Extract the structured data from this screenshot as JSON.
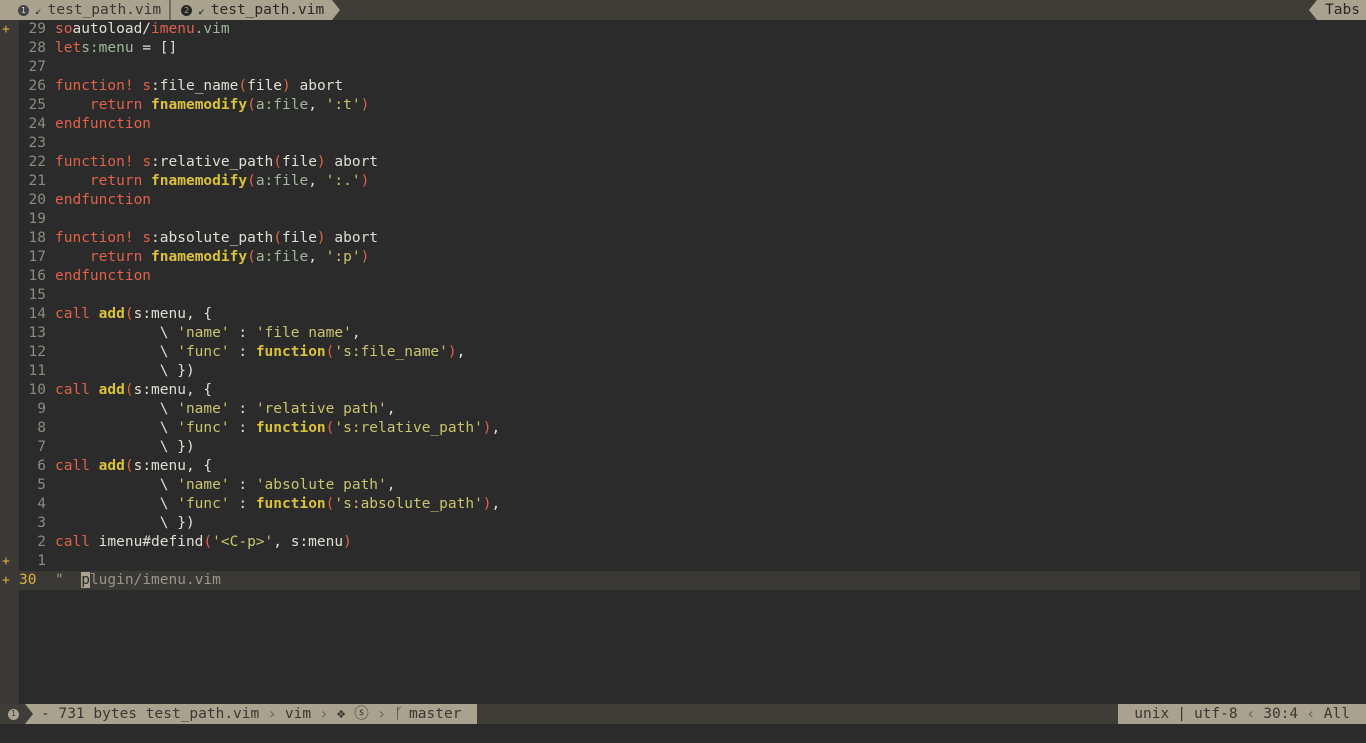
{
  "tabline": {
    "tabs": [
      {
        "num": "1",
        "modified_icon": "↙",
        "label": "test_path.vim",
        "active": false
      },
      {
        "num": "2",
        "modified_icon": "↙",
        "label": "test_path.vim",
        "active": true
      }
    ],
    "right_label": "Tabs"
  },
  "signs": [
    "+",
    "+",
    "+"
  ],
  "lines": [
    {
      "n": "29",
      "code": [
        [
          "kw",
          "so"
        ],
        [
          "",
          "autoload/"
        ],
        [
          "path",
          "imenu"
        ],
        [
          "ext",
          ".vim"
        ]
      ]
    },
    {
      "n": "28",
      "code": [
        [
          "kw",
          "let"
        ],
        [
          "",
          ""
        ],
        [
          "var",
          "s:menu"
        ],
        [
          "",
          " = []"
        ]
      ]
    },
    {
      "n": "27",
      "code": []
    },
    {
      "n": "26",
      "code": [
        [
          "kw",
          "function!"
        ],
        [
          "",
          " "
        ],
        [
          "kw",
          "s"
        ],
        [
          "",
          ":file_name"
        ],
        [
          "paren",
          "("
        ],
        [
          "",
          "file"
        ],
        [
          "paren",
          ")"
        ],
        [
          "",
          " abort"
        ]
      ]
    },
    {
      "n": "25",
      "code": [
        [
          "",
          "    "
        ],
        [
          "kw",
          "return"
        ],
        [
          "",
          " "
        ],
        [
          "fn",
          "fnamemodify"
        ],
        [
          "paren",
          "("
        ],
        [
          "var",
          "a:file"
        ],
        [
          "",
          ", "
        ],
        [
          "str",
          "':t'"
        ],
        [
          "paren",
          ")"
        ]
      ]
    },
    {
      "n": "24",
      "code": [
        [
          "kw",
          "endfunction"
        ]
      ]
    },
    {
      "n": "23",
      "code": []
    },
    {
      "n": "22",
      "code": [
        [
          "kw",
          "function!"
        ],
        [
          "",
          " "
        ],
        [
          "kw",
          "s"
        ],
        [
          "",
          ":relative_path"
        ],
        [
          "paren",
          "("
        ],
        [
          "",
          "file"
        ],
        [
          "paren",
          ")"
        ],
        [
          "",
          " abort"
        ]
      ]
    },
    {
      "n": "21",
      "code": [
        [
          "",
          "    "
        ],
        [
          "kw",
          "return"
        ],
        [
          "",
          " "
        ],
        [
          "fn",
          "fnamemodify"
        ],
        [
          "paren",
          "("
        ],
        [
          "var",
          "a:file"
        ],
        [
          "",
          ", "
        ],
        [
          "str",
          "':.'"
        ],
        [
          "paren",
          ")"
        ]
      ]
    },
    {
      "n": "20",
      "code": [
        [
          "kw",
          "endfunction"
        ]
      ]
    },
    {
      "n": "19",
      "code": []
    },
    {
      "n": "18",
      "code": [
        [
          "kw",
          "function!"
        ],
        [
          "",
          " "
        ],
        [
          "kw",
          "s"
        ],
        [
          "",
          ":absolute_path"
        ],
        [
          "paren",
          "("
        ],
        [
          "",
          "file"
        ],
        [
          "paren",
          ")"
        ],
        [
          "",
          " abort"
        ]
      ]
    },
    {
      "n": "17",
      "code": [
        [
          "",
          "    "
        ],
        [
          "kw",
          "return"
        ],
        [
          "",
          " "
        ],
        [
          "fn",
          "fnamemodify"
        ],
        [
          "paren",
          "("
        ],
        [
          "var",
          "a:file"
        ],
        [
          "",
          ", "
        ],
        [
          "str",
          "':p'"
        ],
        [
          "paren",
          ")"
        ]
      ]
    },
    {
      "n": "16",
      "code": [
        [
          "kw",
          "endfunction"
        ]
      ]
    },
    {
      "n": "15",
      "code": []
    },
    {
      "n": "14",
      "code": [
        [
          "kw",
          "call"
        ],
        [
          "",
          " "
        ],
        [
          "fn",
          "add"
        ],
        [
          "paren",
          "("
        ],
        [
          "",
          "s:menu, {"
        ]
      ]
    },
    {
      "n": "13",
      "code": [
        [
          "",
          "            \\ "
        ],
        [
          "str",
          "'name'"
        ],
        [
          "",
          " : "
        ],
        [
          "str",
          "'file name'"
        ],
        [
          "",
          ","
        ]
      ]
    },
    {
      "n": "12",
      "code": [
        [
          "",
          "            \\ "
        ],
        [
          "str",
          "'func'"
        ],
        [
          "",
          " : "
        ],
        [
          "fn",
          "function"
        ],
        [
          "paren",
          "("
        ],
        [
          "str",
          "'s:file_name'"
        ],
        [
          "paren",
          ")"
        ],
        [
          "",
          ","
        ]
      ]
    },
    {
      "n": "11",
      "code": [
        [
          "",
          "            \\ })"
        ]
      ]
    },
    {
      "n": "10",
      "code": [
        [
          "kw",
          "call"
        ],
        [
          "",
          " "
        ],
        [
          "fn",
          "add"
        ],
        [
          "paren",
          "("
        ],
        [
          "",
          "s:menu, {"
        ]
      ]
    },
    {
      "n": "9",
      "code": [
        [
          "",
          "            \\ "
        ],
        [
          "str",
          "'name'"
        ],
        [
          "",
          " : "
        ],
        [
          "str",
          "'relative path'"
        ],
        [
          "",
          ","
        ]
      ]
    },
    {
      "n": "8",
      "code": [
        [
          "",
          "            \\ "
        ],
        [
          "str",
          "'func'"
        ],
        [
          "",
          " : "
        ],
        [
          "fn",
          "function"
        ],
        [
          "paren",
          "("
        ],
        [
          "str",
          "'s:relative_path'"
        ],
        [
          "paren",
          ")"
        ],
        [
          "",
          ","
        ]
      ]
    },
    {
      "n": "7",
      "code": [
        [
          "",
          "            \\ })"
        ]
      ]
    },
    {
      "n": "6",
      "code": [
        [
          "kw",
          "call"
        ],
        [
          "",
          " "
        ],
        [
          "fn",
          "add"
        ],
        [
          "paren",
          "("
        ],
        [
          "",
          "s:menu, {"
        ]
      ]
    },
    {
      "n": "5",
      "code": [
        [
          "",
          "            \\ "
        ],
        [
          "str",
          "'name'"
        ],
        [
          "",
          " : "
        ],
        [
          "str",
          "'absolute path'"
        ],
        [
          "",
          ","
        ]
      ]
    },
    {
      "n": "4",
      "code": [
        [
          "",
          "            \\ "
        ],
        [
          "str",
          "'func'"
        ],
        [
          "",
          " : "
        ],
        [
          "fn",
          "function"
        ],
        [
          "paren",
          "("
        ],
        [
          "str",
          "'s:absolute_path'"
        ],
        [
          "paren",
          ")"
        ],
        [
          "",
          ","
        ]
      ]
    },
    {
      "n": "3",
      "code": [
        [
          "",
          "            \\ })"
        ]
      ]
    },
    {
      "n": "2",
      "code": [
        [
          "kw",
          "call"
        ],
        [
          "",
          " imenu#defind"
        ],
        [
          "paren",
          "("
        ],
        [
          "str",
          "'<C-p>'"
        ],
        [
          "",
          ", s:menu"
        ],
        [
          "paren",
          ")"
        ]
      ]
    },
    {
      "n": "1",
      "code": []
    },
    {
      "n": "30",
      "current": true,
      "code": [
        [
          "cmt",
          "\"  "
        ],
        [
          "cursor",
          "p"
        ],
        [
          "cmt",
          "lugin/imenu.vim"
        ]
      ]
    }
  ],
  "statusline": {
    "buffer_num": "1",
    "file_info": "- 731 bytes test_path.vim",
    "filetype": "vim",
    "flags": "❖ ⓢ",
    "branch_icon": "ᚴ",
    "branch": "master",
    "fileformat": "unix",
    "encoding_sep": "|",
    "encoding": "utf-8",
    "position": "30:4",
    "percent": "All"
  }
}
